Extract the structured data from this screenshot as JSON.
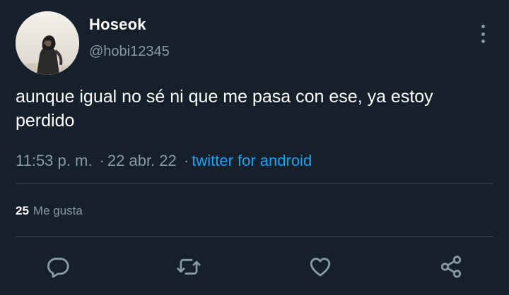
{
  "user": {
    "display_name": "Hoseok",
    "handle": "@hobi12345",
    "avatar_icon": "profile-photo"
  },
  "tweet": {
    "text": "aunque igual no sé ni que me pasa con ese, ya estoy perdido",
    "time": "11:53 p. m.",
    "separator": "·",
    "date": "22 abr. 22",
    "source": "twitter for android"
  },
  "stats": {
    "likes_count": "25",
    "likes_label": "Me gusta"
  },
  "actions": [
    "reply-icon",
    "retweet-icon",
    "like-icon",
    "share-icon"
  ],
  "colors": {
    "background": "#15202b",
    "text": "#ffffff",
    "muted": "#8899a6",
    "link": "#1da1f2",
    "divider": "#38444d"
  }
}
